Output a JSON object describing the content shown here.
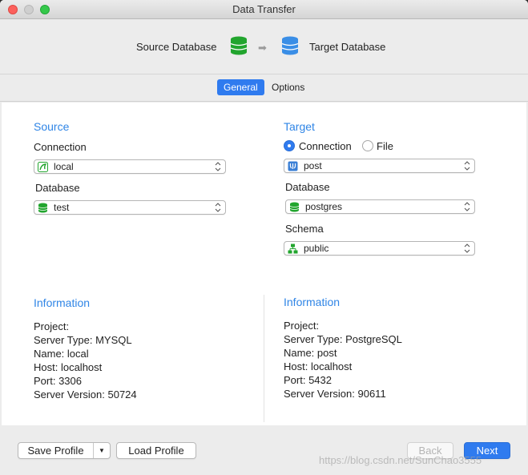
{
  "window": {
    "title": "Data Transfer"
  },
  "header": {
    "source_label": "Source Database",
    "target_label": "Target Database"
  },
  "tabs": [
    {
      "label": "General",
      "active": true
    },
    {
      "label": "Options",
      "active": false
    }
  ],
  "source": {
    "title": "Source",
    "connection_label": "Connection",
    "connection_value": "local",
    "database_label": "Database",
    "database_value": "test"
  },
  "target": {
    "title": "Target",
    "radio_connection": "Connection",
    "radio_file": "File",
    "connection_value": "post",
    "database_label": "Database",
    "database_value": "postgres",
    "schema_label": "Schema",
    "schema_value": "public"
  },
  "source_info": {
    "title": "Information",
    "lines": [
      "Project:",
      "Server Type: MYSQL",
      "Name: local",
      "Host: localhost",
      "Port: 3306",
      "Server Version: 50724"
    ]
  },
  "target_info": {
    "title": "Information",
    "lines": [
      "Project:",
      "Server Type: PostgreSQL",
      "Name: post",
      "Host: localhost",
      "Port: 5432",
      "Server Version: 90611"
    ]
  },
  "footer": {
    "save_profile": "Save Profile",
    "load_profile": "Load Profile",
    "back": "Back",
    "next": "Next",
    "watermark": "https://blog.csdn.net/SunChao3555"
  },
  "colors": {
    "accent": "#2f7bef",
    "section_title": "#2f85e6",
    "db_green": "#22a52e",
    "db_blue": "#3a8ee6"
  }
}
